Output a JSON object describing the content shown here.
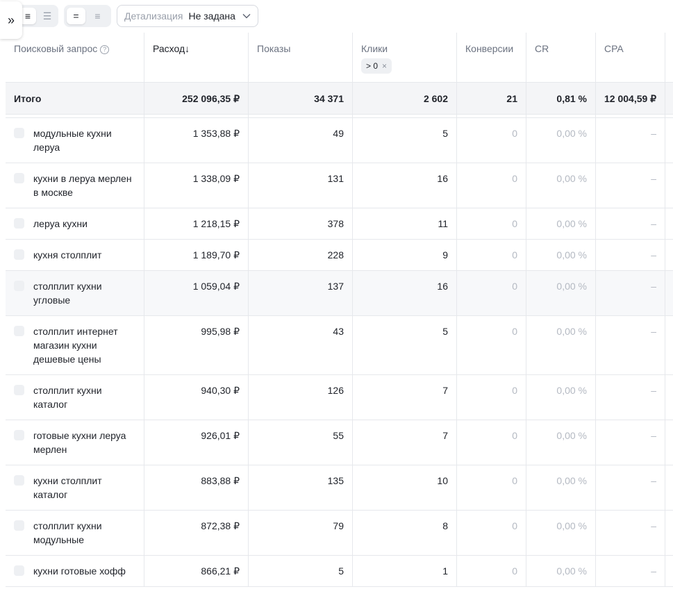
{
  "toolbar": {
    "expand_icon": "»",
    "view_mode_1": [
      "≡",
      "☰"
    ],
    "view_mode_2": [
      "=",
      "≡"
    ],
    "detail_label": "Детализация",
    "detail_value": "Не задана"
  },
  "table": {
    "columns": [
      {
        "label": "Поисковый запрос",
        "help": "?"
      },
      {
        "label": "Расход",
        "sort": "↓"
      },
      {
        "label": "Показы"
      },
      {
        "label": "Клики",
        "filter": "> 0",
        "filter_close": "×"
      },
      {
        "label": "Конверсии"
      },
      {
        "label": "CR"
      },
      {
        "label": "CPA"
      }
    ],
    "total": {
      "label": "Итого",
      "spend": "252 096,35 ₽",
      "shows": "34 371",
      "clicks": "2 602",
      "conversions": "21",
      "cr": "0,81 %",
      "cpa": "12 004,59 ₽"
    },
    "rows": [
      {
        "query": "модульные кухни леруа",
        "spend": "1 353,88 ₽",
        "shows": "49",
        "clicks": "5",
        "conversions": "0",
        "cr": "0,00 %",
        "cpa": "–"
      },
      {
        "query": "кухни в леруа мерлен в москве",
        "spend": "1 338,09 ₽",
        "shows": "131",
        "clicks": "16",
        "conversions": "0",
        "cr": "0,00 %",
        "cpa": "–"
      },
      {
        "query": "леруа кухни",
        "spend": "1 218,15 ₽",
        "shows": "378",
        "clicks": "11",
        "conversions": "0",
        "cr": "0,00 %",
        "cpa": "–"
      },
      {
        "query": "кухня столплит",
        "spend": "1 189,70 ₽",
        "shows": "228",
        "clicks": "9",
        "conversions": "0",
        "cr": "0,00 %",
        "cpa": "–"
      },
      {
        "query": "столплит кухни угловые",
        "spend": "1 059,04 ₽",
        "shows": "137",
        "clicks": "16",
        "conversions": "0",
        "cr": "0,00 %",
        "cpa": "–"
      },
      {
        "query": "столплит интернет магазин кухни дешевые цены",
        "spend": "995,98 ₽",
        "shows": "43",
        "clicks": "5",
        "conversions": "0",
        "cr": "0,00 %",
        "cpa": "–"
      },
      {
        "query": "столплит кухни каталог",
        "spend": "940,30 ₽",
        "shows": "126",
        "clicks": "7",
        "conversions": "0",
        "cr": "0,00 %",
        "cpa": "–"
      },
      {
        "query": "готовые кухни леруа мерлен",
        "spend": "926,01 ₽",
        "shows": "55",
        "clicks": "7",
        "conversions": "0",
        "cr": "0,00 %",
        "cpa": "–"
      },
      {
        "query": "кухни столплит каталог",
        "spend": "883,88 ₽",
        "shows": "135",
        "clicks": "10",
        "conversions": "0",
        "cr": "0,00 %",
        "cpa": "–"
      },
      {
        "query": "столплит кухни модульные",
        "spend": "872,38 ₽",
        "shows": "79",
        "clicks": "8",
        "conversions": "0",
        "cr": "0,00 %",
        "cpa": "–"
      },
      {
        "query": "кухни готовые хофф",
        "spend": "866,21 ₽",
        "shows": "5",
        "clicks": "1",
        "conversions": "0",
        "cr": "0,00 %",
        "cpa": "–"
      }
    ]
  }
}
